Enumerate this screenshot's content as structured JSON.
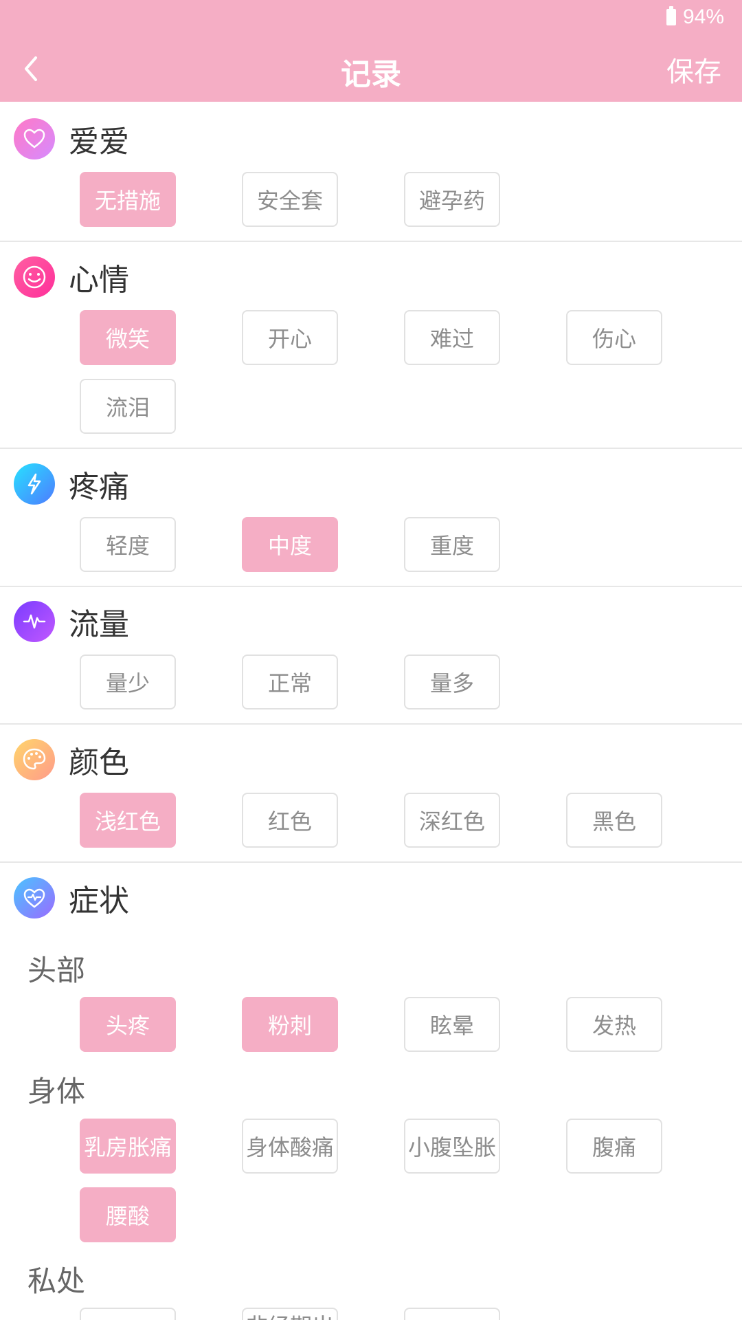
{
  "status": {
    "battery": "94%"
  },
  "header": {
    "title": "记录",
    "save": "保存"
  },
  "sections": {
    "love": {
      "title": "爱爱",
      "options": [
        "无措施",
        "安全套",
        "避孕药"
      ],
      "selected": [
        "无措施"
      ]
    },
    "mood": {
      "title": "心情",
      "options": [
        "微笑",
        "开心",
        "难过",
        "伤心",
        "流泪"
      ],
      "selected": [
        "微笑"
      ]
    },
    "pain": {
      "title": "疼痛",
      "options": [
        "轻度",
        "中度",
        "重度"
      ],
      "selected": [
        "中度"
      ]
    },
    "flow": {
      "title": "流量",
      "options": [
        "量少",
        "正常",
        "量多"
      ],
      "selected": []
    },
    "color": {
      "title": "颜色",
      "options": [
        "浅红色",
        "红色",
        "深红色",
        "黑色"
      ],
      "selected": [
        "浅红色"
      ]
    },
    "symptoms": {
      "title": "症状",
      "head": {
        "title": "头部",
        "options": [
          "头疼",
          "粉刺",
          "眩晕",
          "发热"
        ],
        "selected": [
          "头疼",
          "粉刺"
        ]
      },
      "body": {
        "title": "身体",
        "options": [
          "乳房胀痛",
          "身体酸痛",
          "小腹坠胀",
          "腹痛",
          "腰酸"
        ],
        "selected": [
          "乳房胀痛",
          "腰酸"
        ]
      },
      "private": {
        "title": "私处",
        "options": [
          "",
          "非经期出",
          ""
        ]
      }
    }
  },
  "colors": {
    "accent": "#f5aec5",
    "divider": "#e7e7e7"
  },
  "icons": {
    "love": "heart-icon",
    "mood": "smile-icon",
    "pain": "lightning-icon",
    "flow": "pulse-icon",
    "color": "palette-icon",
    "symptoms": "heart-pulse-icon"
  }
}
